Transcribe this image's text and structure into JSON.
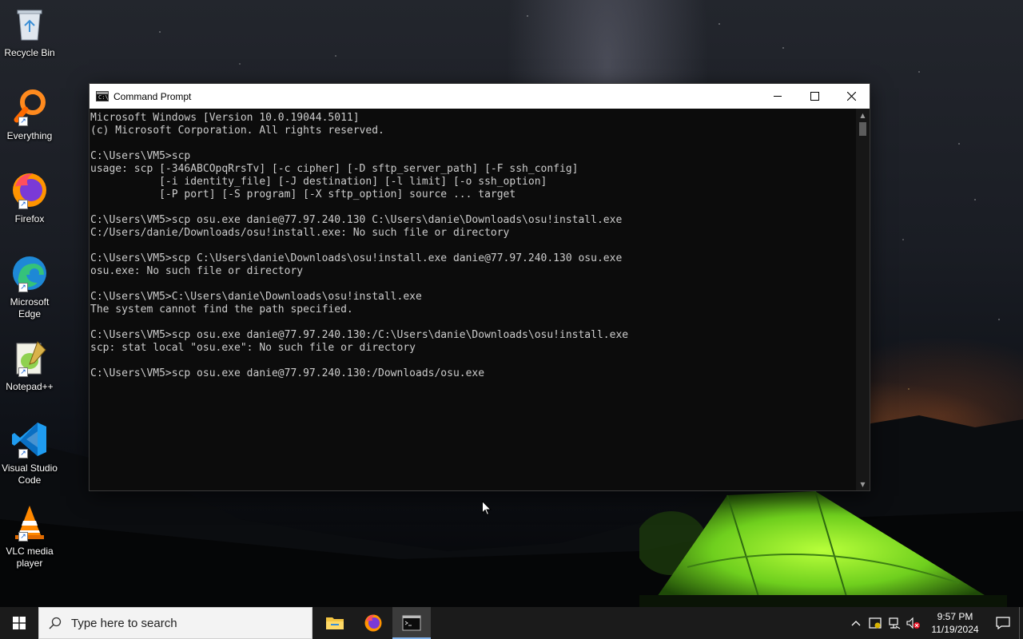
{
  "desktop": {
    "icons": [
      {
        "label": "Recycle Bin",
        "icon": "recycle-bin-icon"
      },
      {
        "label": "Everything",
        "icon": "everything-search-icon"
      },
      {
        "label": "Firefox",
        "icon": "firefox-icon"
      },
      {
        "label": "Microsoft Edge",
        "icon": "edge-icon"
      },
      {
        "label": "Notepad++",
        "icon": "notepad-plus-plus-icon"
      },
      {
        "label": "Visual Studio Code",
        "icon": "vscode-icon"
      },
      {
        "label": "VLC media player",
        "icon": "vlc-icon"
      }
    ]
  },
  "window": {
    "title": "Command Prompt",
    "lines": [
      "Microsoft Windows [Version 10.0.19044.5011]",
      "(c) Microsoft Corporation. All rights reserved.",
      "",
      "C:\\Users\\VM5>scp",
      "usage: scp [-346ABCOpqRrsTv] [-c cipher] [-D sftp_server_path] [-F ssh_config]",
      "           [-i identity_file] [-J destination] [-l limit] [-o ssh_option]",
      "           [-P port] [-S program] [-X sftp_option] source ... target",
      "",
      "C:\\Users\\VM5>scp osu.exe danie@77.97.240.130 C:\\Users\\danie\\Downloads\\osu!install.exe",
      "C:/Users/danie/Downloads/osu!install.exe: No such file or directory",
      "",
      "C:\\Users\\VM5>scp C:\\Users\\danie\\Downloads\\osu!install.exe danie@77.97.240.130 osu.exe",
      "osu.exe: No such file or directory",
      "",
      "C:\\Users\\VM5>C:\\Users\\danie\\Downloads\\osu!install.exe",
      "The system cannot find the path specified.",
      "",
      "C:\\Users\\VM5>scp osu.exe danie@77.97.240.130:/C:\\Users\\danie\\Downloads\\osu!install.exe",
      "scp: stat local \"osu.exe\": No such file or directory",
      "",
      "C:\\Users\\VM5>scp osu.exe danie@77.97.240.130:/Downloads/osu.exe"
    ]
  },
  "taskbar": {
    "search_placeholder": "Type here to search",
    "apps": [
      {
        "name": "File Explorer",
        "icon": "file-explorer-icon",
        "active": false
      },
      {
        "name": "Firefox",
        "icon": "firefox-icon",
        "active": false
      },
      {
        "name": "Command Prompt",
        "icon": "command-prompt-icon",
        "active": true
      }
    ],
    "time": "9:57 PM",
    "date": "11/19/2024"
  },
  "colors": {
    "console_bg": "#0c0c0c",
    "console_text": "#cccccc",
    "taskbar_bg": "#1b1b1b",
    "active_indicator": "#7fb0e8"
  }
}
